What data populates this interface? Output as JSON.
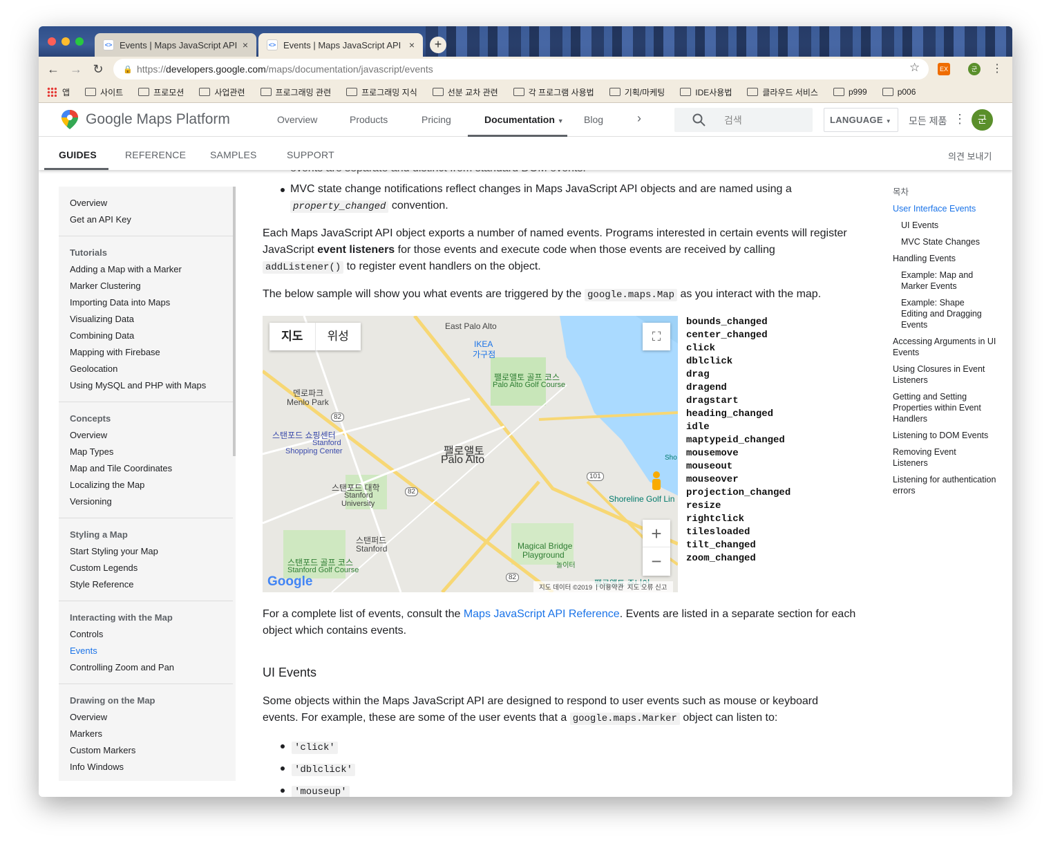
{
  "tabs": [
    {
      "title": "Events | Maps JavaScript API",
      "close": "×"
    },
    {
      "title": "Events | Maps JavaScript API",
      "close": "×"
    }
  ],
  "new_tab": "+",
  "url": {
    "scheme": "https://",
    "host": "developers.google.com",
    "path": "/maps/documentation/javascript/events"
  },
  "bookmarks": [
    "앱",
    "사이트",
    "프로모션",
    "사업관련",
    "프로그래밍 관련",
    "프로그래밍 지식",
    "선분 교차 관련",
    "각 프로그램 사용법",
    "기획/마케팅",
    "IDE사용법",
    "클라우드 서비스",
    "p999",
    "p006"
  ],
  "extensions": {
    "ex": "EX",
    "profile": "군"
  },
  "site": {
    "brand": "Google Maps Platform",
    "nav": [
      "Overview",
      "Products",
      "Pricing",
      "Documentation",
      "Blog"
    ],
    "search_placeholder": "검색",
    "language": "LANGUAGE",
    "all_products": "모든 제품",
    "avatar": "군"
  },
  "subnav": {
    "tabs": [
      "GUIDES",
      "REFERENCE",
      "SAMPLES",
      "SUPPORT"
    ],
    "feedback": "의견 보내기"
  },
  "leftnav": {
    "top": [
      "Overview",
      "Get an API Key"
    ],
    "sections": [
      {
        "heading": "Tutorials",
        "items": [
          "Adding a Map with a Marker",
          "Marker Clustering",
          "Importing Data into Maps",
          "Visualizing Data",
          "Combining Data",
          "Mapping with Firebase",
          "Geolocation",
          "Using MySQL and PHP with Maps"
        ]
      },
      {
        "heading": "Concepts",
        "items": [
          "Overview",
          "Map Types",
          "Map and Tile Coordinates",
          "Localizing the Map",
          "Versioning"
        ]
      },
      {
        "heading": "Styling a Map",
        "items": [
          "Start Styling your Map",
          "Custom Legends",
          "Style Reference"
        ]
      },
      {
        "heading": "Interacting with the Map",
        "items": [
          "Controls",
          "Events",
          "Controlling Zoom and Pan"
        ]
      },
      {
        "heading": "Drawing on the Map",
        "items": [
          "Overview",
          "Markers",
          "Custom Markers",
          "Info Windows"
        ]
      }
    ],
    "current": "Events"
  },
  "article": {
    "cut_line": "events are separate and distinct from standard DOM events.",
    "bullet_mvc_a": "MVC state change notifications reflect changes in Maps JavaScript API objects and are named using a",
    "bullet_mvc_code": "property_changed",
    "bullet_mvc_b": " convention.",
    "p1_a": "Each Maps JavaScript API object exports a number of named events. Programs interested in certain events will register JavaScript ",
    "p1_bold": "event listeners",
    "p1_b": " for those events and execute code when those events are received by calling ",
    "p1_code": "addListener()",
    "p1_c": " to register event handlers on the object.",
    "p2_a": "The below sample will show you what events are triggered by the ",
    "p2_code": "google.maps.Map",
    "p2_b": " as you interact with the map.",
    "p3_a": "For a complete list of events, consult the ",
    "p3_link": "Maps JavaScript API Reference",
    "p3_b": ". Events are listed in a separate section for each object which contains events.",
    "h_ui": "UI Events",
    "p4_a": "Some objects within the Maps JavaScript API are designed to respond to user events such as mouse or keyboard events. For example, these are some of the user events that a ",
    "p4_code": "google.maps.Marker",
    "p4_b": " object can listen to:",
    "bullets": [
      "'click'",
      "'dblclick'",
      "'mouseup'"
    ]
  },
  "map": {
    "type_buttons": [
      "지도",
      "위성"
    ],
    "labels": [
      "East Palo Alto",
      "IKEA",
      "가구점",
      "멘로파크",
      "Menlo Park",
      "팰로앨토 골프 코스",
      "Palo Alto Golf Course",
      "스탠포드 쇼핑센터",
      "Stanford",
      "Shopping Center",
      "팰로앨토",
      "Palo Alto",
      "스탠포드 대학",
      "Stanford",
      "University",
      "스탠퍼드",
      "Stanford",
      "스탠포드 골프 코스",
      "Stanford Golf Course",
      "Magical Bridge",
      "Playground",
      "놀이터",
      "Shoreline Golf Lin",
      "Sho",
      "팰로앨토 주니어"
    ],
    "shields": [
      "82",
      "82",
      "82",
      "101"
    ],
    "google": "Google",
    "footer": [
      "지도 데이터 ©2019",
      "이용약관",
      "지도 오류 신고"
    ]
  },
  "events_list": [
    "bounds_changed",
    "center_changed",
    "click",
    "dblclick",
    "drag",
    "dragend",
    "dragstart",
    "heading_changed",
    "idle",
    "maptypeid_changed",
    "mousemove",
    "mouseout",
    "mouseover",
    "projection_changed",
    "resize",
    "rightclick",
    "tilesloaded",
    "tilt_changed",
    "zoom_changed"
  ],
  "toc": {
    "title": "목차",
    "items": [
      "User Interface Events",
      "UI Events",
      "MVC State Changes",
      "Handling Events",
      "Example: Map and Marker Events",
      "Example: Shape Editing and Dragging Events",
      "Accessing Arguments in UI Events",
      "Using Closures in Event Listeners",
      "Getting and Setting Properties within Event Handlers",
      "Listening to DOM Events",
      "Removing Event Listeners",
      "Listening for authentication errors"
    ]
  },
  "colors": {
    "link": "#1a73e8",
    "text": "#202124",
    "avatar": "#5a8f2b"
  }
}
